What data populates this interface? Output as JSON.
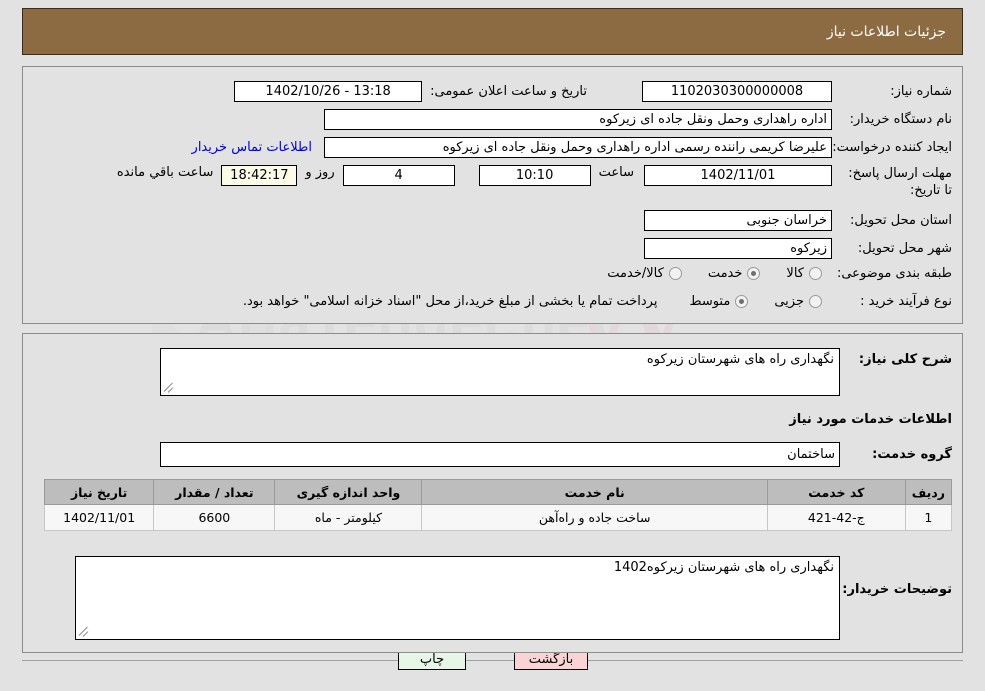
{
  "header": {
    "title": "جزئیات اطلاعات نیاز"
  },
  "watermark": {
    "text": "AriaTender.net"
  },
  "form": {
    "need_number_label": "شماره نیاز:",
    "need_number_value": "1102030300000008",
    "announce_label": "تاریخ و ساعت اعلان عمومی:",
    "announce_value": "13:18 - 1402/10/26",
    "buyer_org_label": "نام دستگاه خریدار:",
    "buyer_org_value": "اداره راهداری وحمل ونقل جاده ای زیرکوه",
    "requester_label": "ایجاد کننده درخواست:",
    "requester_value": "علیرضا کریمی راننده رسمی اداره راهداری وحمل ونقل جاده ای زیرکوه",
    "contact_link": "اطلاعات تماس خریدار",
    "deadline_label": "مهلت ارسال پاسخ: تا تاریخ:",
    "deadline_date": "1402/11/01",
    "hour_label": "ساعت",
    "deadline_time": "10:10",
    "days_value": "4",
    "days_label": "روز و",
    "countdown_value": "18:42:17",
    "remaining_label": "ساعت باقي مانده",
    "province_label": "استان محل تحویل:",
    "province_value": "خراسان جنوبی",
    "city_label": "شهر محل تحویل:",
    "city_value": "زیرکوه",
    "category_label": "طبقه بندی موضوعی:",
    "category_options": [
      {
        "label": "کالا",
        "selected": false
      },
      {
        "label": "خدمت",
        "selected": true
      },
      {
        "label": "کالا/خدمت",
        "selected": false
      }
    ],
    "process_label": "نوع فرآیند خرید :",
    "process_options": [
      {
        "label": "جزیی",
        "selected": false
      },
      {
        "label": "متوسط",
        "selected": true
      }
    ],
    "process_note": "پرداخت تمام یا بخشی از مبلغ خرید،از محل \"اسناد خزانه اسلامی\" خواهد بود."
  },
  "details": {
    "summary_label": "شرح کلی نیاز:",
    "summary_value": "نگهداری راه های شهرستان زیرکوه",
    "services_heading": "اطلاعات خدمات مورد نیاز",
    "service_group_label": "گروه خدمت:",
    "service_group_value": "ساختمان",
    "buyer_notes_label": "توضیحات خریدار:",
    "buyer_notes_value": "نگهداری راه های شهرستان زیرکوه1402"
  },
  "table": {
    "columns": [
      "ردیف",
      "کد خدمت",
      "نام خدمت",
      "واحد اندازه گیری",
      "تعداد / مقدار",
      "تاریخ نیاز"
    ],
    "rows": [
      {
        "row_no": "1",
        "service_code": "ج-42-421",
        "service_name": "ساخت جاده و راه‌آهن",
        "unit": "کیلومتر - ماه",
        "quantity": "6600",
        "need_date": "1402/11/01"
      }
    ]
  },
  "footer": {
    "print_label": "چاپ",
    "back_label": "بازگشت"
  }
}
